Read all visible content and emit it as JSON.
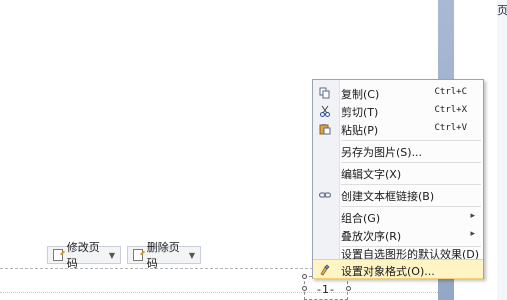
{
  "toolbar": {
    "edit_page_number": "修改页码",
    "delete_page_number": "删除页码"
  },
  "page_number_field": "-1-",
  "right_edge_text": "页",
  "context_menu": {
    "copy": {
      "label": "复制(C)",
      "shortcut": "Ctrl+C"
    },
    "cut": {
      "label": "剪切(T)",
      "shortcut": "Ctrl+X"
    },
    "paste": {
      "label": "粘贴(P)",
      "shortcut": "Ctrl+V"
    },
    "save_as_picture": {
      "label": "另存为图片(S)..."
    },
    "edit_text": {
      "label": "编辑文字(X)"
    },
    "create_textbox_link": {
      "label": "创建文本框链接(B)"
    },
    "group": {
      "label": "组合(G)"
    },
    "stacking_order": {
      "label": "叠放次序(R)"
    },
    "set_default_effect": {
      "label": "设置自选图形的默认效果(D)"
    },
    "format_object": {
      "label": "设置对象格式(O)..."
    }
  },
  "icons": [
    "copy-icon",
    "cut-icon",
    "paste-icon",
    "link-icon",
    "format-object-icon",
    "edit-icon",
    "delete-icon"
  ],
  "colors": {
    "highlight": "#fff4c4",
    "right_rail": "#a9b9d3"
  }
}
